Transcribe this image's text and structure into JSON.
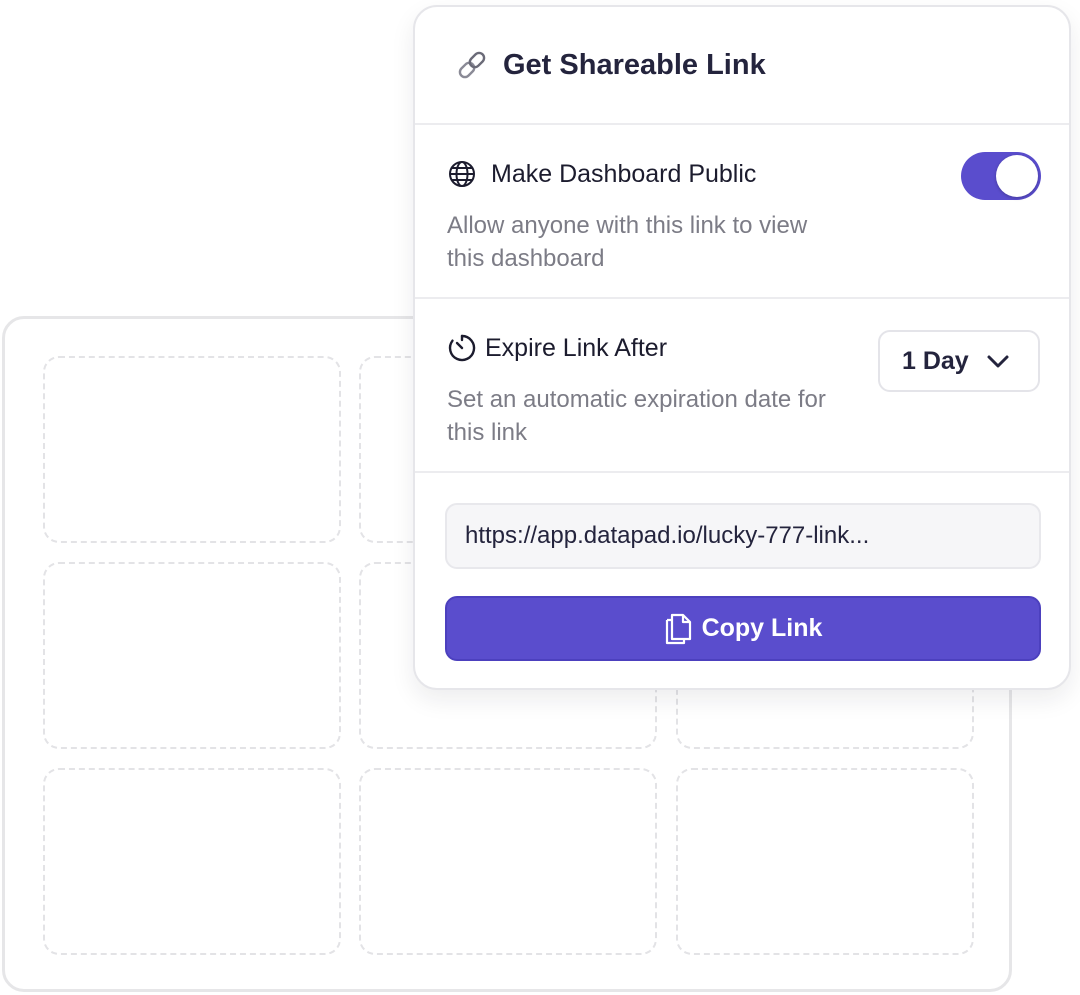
{
  "popover": {
    "title": "Get Shareable Link",
    "title_icon": "link-icon",
    "public": {
      "icon": "globe-icon",
      "label": "Make Dashboard Public",
      "description": "Allow anyone with this link to view this dashboard",
      "enabled": true
    },
    "expire": {
      "icon": "timer-icon",
      "label": "Expire Link After",
      "description": "Set an automatic expiration date for this link",
      "selected": "1 Day"
    },
    "link": {
      "value": "https://app.datapad.io/lucky-777-link..."
    },
    "copy_button": {
      "label": "Copy Link",
      "icon": "copy-icon"
    }
  },
  "colors": {
    "accent": "#5a4dcd",
    "title_text": "#24243d",
    "muted_text": "#7c7c86",
    "border": "#e6e6ea"
  }
}
